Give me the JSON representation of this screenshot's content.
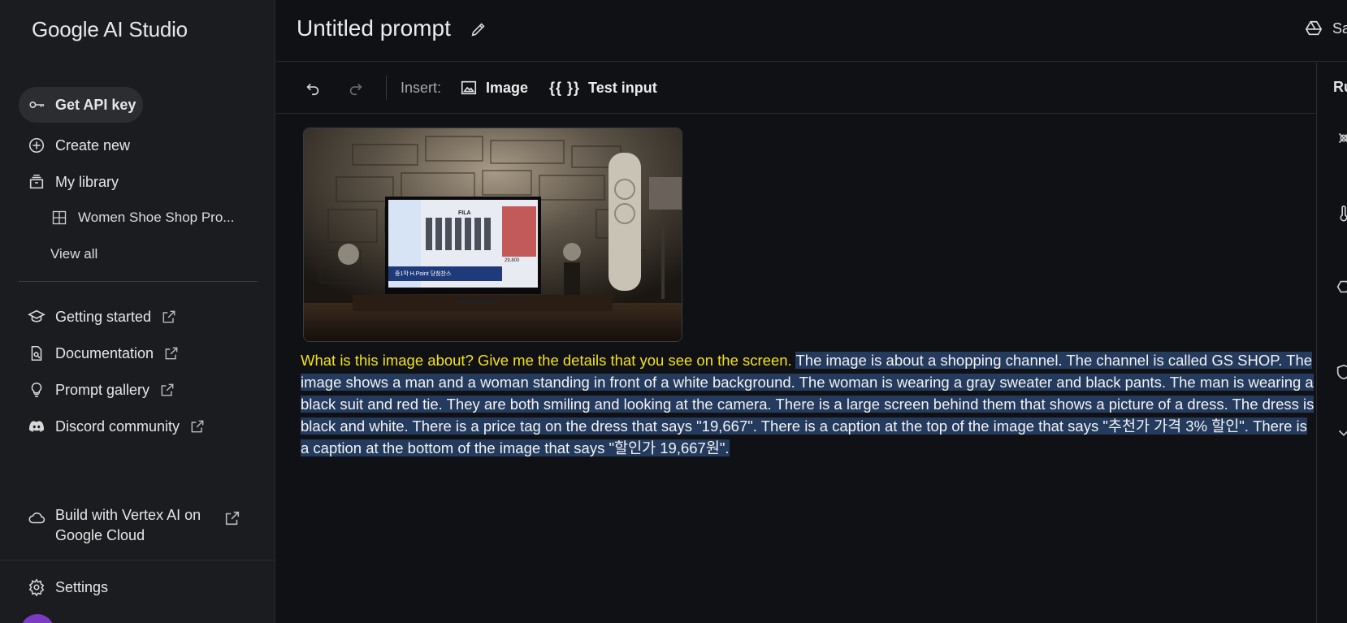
{
  "app": {
    "brand": "Google AI Studio"
  },
  "sidebar": {
    "api_key": "Get API key",
    "create_new": "Create new",
    "my_library": "My library",
    "library_item": "Women Shoe Shop Pro...",
    "view_all": "View all",
    "links": [
      {
        "label": "Getting started",
        "icon": "graduation-cap-icon"
      },
      {
        "label": "Documentation",
        "icon": "doc-search-icon"
      },
      {
        "label": "Prompt gallery",
        "icon": "lightbulb-icon"
      },
      {
        "label": "Discord community",
        "icon": "discord-icon"
      }
    ],
    "vertex": "Build with Vertex AI on Google Cloud",
    "settings": "Settings"
  },
  "header": {
    "title": "Untitled prompt",
    "save_label": "Sa"
  },
  "toolbar": {
    "insert_label": "Insert:",
    "image_label": "Image",
    "braces": "{{ }}",
    "test_input_label": "Test input"
  },
  "right_panel": {
    "heading": "Ru"
  },
  "content": {
    "question": "What is this image about? Give me the details that you see on the screen.",
    "answer": "The image is about a shopping channel. The channel is called GS SHOP. The image shows a man and a woman standing in front of a white background. The woman is wearing a gray sweater and black pants. The man is wearing a black suit and red tie. They are both smiling and looking at the camera. There is a large screen behind them that shows a picture of a dress. The dress is black and white. There is a price tag on the dress that says \"19,667\". There is a caption at the top of the image that says \"추천가 가격 3% 할인\". There is a caption at the bottom of the image that says \"할인가 19,667원\".",
    "tv_brand_on_screen": "FILA",
    "tv_banner_text": "종1막 H.Point 당첨찬스",
    "tv_price": "29,800"
  },
  "colors": {
    "accent_highlight": "#f5e11a",
    "selection": "#243b5e"
  }
}
